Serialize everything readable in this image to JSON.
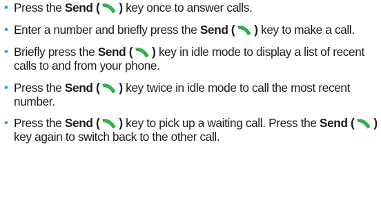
{
  "bullet_symbol": "•",
  "icon": {
    "name": "send-handset-icon",
    "color": "#2db84a"
  },
  "accent_color": "#27a4df",
  "items": [
    {
      "before": "Press the ",
      "key": "Send",
      "open": "(",
      "close": ")",
      "after": " key once to answer calls."
    },
    {
      "before": "Enter a number and briefly press the ",
      "key": "Send",
      "open": "(",
      "close": ")",
      "after": " key to make a call."
    },
    {
      "before": "Briefly press the ",
      "key": "Send",
      "open": "(",
      "close": ")",
      "after": " key in idle mode to display a list of recent calls to and from your phone."
    },
    {
      "before": "Press the ",
      "key": "Send",
      "open": "(",
      "close": ")",
      "after": " key twice in idle mode to call the most recent number."
    },
    {
      "before": "Press the ",
      "key": "Send",
      "open": "(",
      "close": ")",
      "after": " key to pick up a waiting call. Press the ",
      "key2": "Send",
      "open2": "(",
      "close2": ")",
      "after2": " key again to switch back to the other call."
    }
  ]
}
